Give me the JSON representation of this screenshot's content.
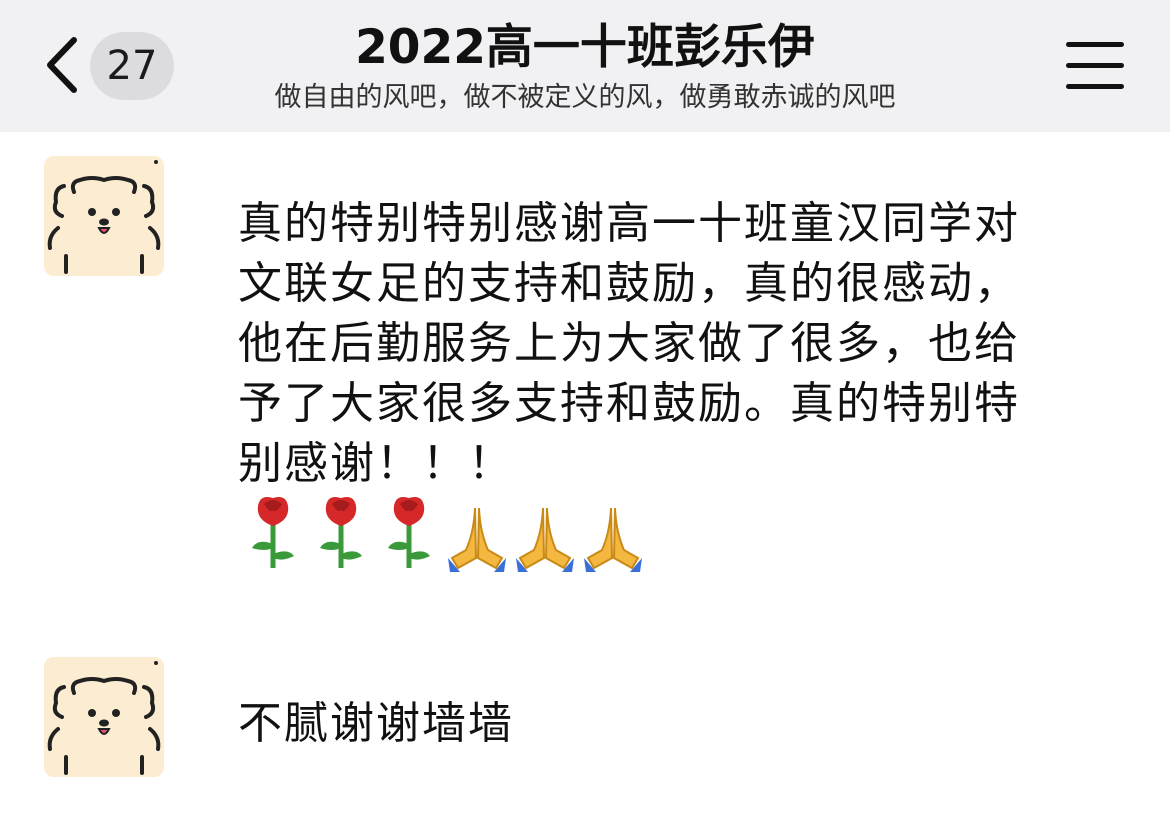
{
  "header": {
    "back_count": "27",
    "title": "2022高一十班彭乐伊",
    "subtitle": "做自由的风吧，做不被定义的风，做勇敢赤诚的风吧"
  },
  "messages": [
    {
      "text": "真的特别特别感谢高一十班童汉同学对文联女足的支持和鼓励，真的很感动，他在后勤服务上为大家做了很多，也给予了大家很多支持和鼓励。真的特别特别感谢！！！",
      "emojis": [
        "rose",
        "rose",
        "rose",
        "folded-hands",
        "folded-hands",
        "folded-hands"
      ]
    },
    {
      "text": "不腻谢谢墙墙"
    }
  ],
  "colors": {
    "header_bg": "#f1f1f3",
    "badge_bg": "#dcdce0",
    "avatar_bg": "#fbecd2"
  }
}
